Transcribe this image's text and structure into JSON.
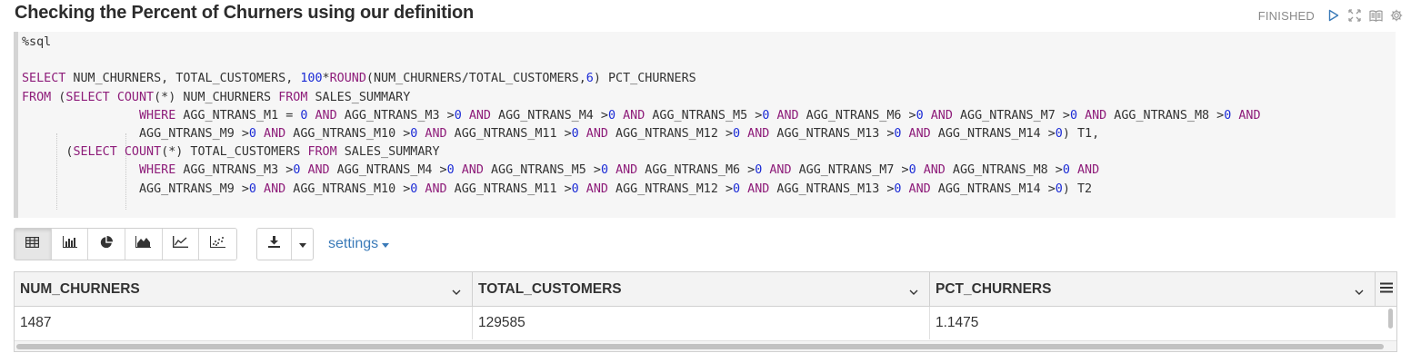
{
  "paragraph": {
    "title": "Checking the Percent of Churners using our definition",
    "status": "FINISHED",
    "controls": [
      "run-icon",
      "expand-icon",
      "book-icon",
      "gear-icon"
    ]
  },
  "editor": {
    "lines": [
      [
        {
          "t": "%sql",
          "c": ""
        }
      ],
      [
        {
          "t": "",
          "c": ""
        }
      ],
      [
        {
          "t": "SELECT",
          "c": "kw"
        },
        {
          "t": " NUM_CHURNERS, TOTAL_CUSTOMERS, ",
          "c": ""
        },
        {
          "t": "100",
          "c": "num"
        },
        {
          "t": "*",
          "c": ""
        },
        {
          "t": "ROUND",
          "c": "kw"
        },
        {
          "t": "(NUM_CHURNERS/TOTAL_CUSTOMERS,",
          "c": ""
        },
        {
          "t": "6",
          "c": "num"
        },
        {
          "t": ") PCT_CHURNERS",
          "c": ""
        }
      ],
      [
        {
          "t": "FROM",
          "c": "kw"
        },
        {
          "t": " (",
          "c": ""
        },
        {
          "t": "SELECT",
          "c": "kw"
        },
        {
          "t": " ",
          "c": ""
        },
        {
          "t": "COUNT",
          "c": "kw"
        },
        {
          "t": "(*) NUM_CHURNERS ",
          "c": ""
        },
        {
          "t": "FROM",
          "c": "kw"
        },
        {
          "t": " SALES_SUMMARY",
          "c": ""
        }
      ],
      [
        {
          "t": "                ",
          "c": ""
        },
        {
          "t": "WHERE",
          "c": "kw"
        },
        {
          "t": " AGG_NTRANS_M1 = ",
          "c": ""
        },
        {
          "t": "0",
          "c": "num"
        },
        {
          "t": " ",
          "c": ""
        },
        {
          "t": "AND",
          "c": "kw"
        },
        {
          "t": " AGG_NTRANS_M3 >",
          "c": ""
        },
        {
          "t": "0",
          "c": "num"
        },
        {
          "t": " ",
          "c": ""
        },
        {
          "t": "AND",
          "c": "kw"
        },
        {
          "t": " AGG_NTRANS_M4 >",
          "c": ""
        },
        {
          "t": "0",
          "c": "num"
        },
        {
          "t": " ",
          "c": ""
        },
        {
          "t": "AND",
          "c": "kw"
        },
        {
          "t": " AGG_NTRANS_M5 >",
          "c": ""
        },
        {
          "t": "0",
          "c": "num"
        },
        {
          "t": " ",
          "c": ""
        },
        {
          "t": "AND",
          "c": "kw"
        },
        {
          "t": " AGG_NTRANS_M6 >",
          "c": ""
        },
        {
          "t": "0",
          "c": "num"
        },
        {
          "t": " ",
          "c": ""
        },
        {
          "t": "AND",
          "c": "kw"
        },
        {
          "t": " AGG_NTRANS_M7 >",
          "c": ""
        },
        {
          "t": "0",
          "c": "num"
        },
        {
          "t": " ",
          "c": ""
        },
        {
          "t": "AND",
          "c": "kw"
        },
        {
          "t": " AGG_NTRANS_M8 >",
          "c": ""
        },
        {
          "t": "0",
          "c": "num"
        },
        {
          "t": " ",
          "c": ""
        },
        {
          "t": "AND",
          "c": "kw"
        }
      ],
      [
        {
          "t": "                AGG_NTRANS_M9 >",
          "c": ""
        },
        {
          "t": "0",
          "c": "num"
        },
        {
          "t": " ",
          "c": ""
        },
        {
          "t": "AND",
          "c": "kw"
        },
        {
          "t": " AGG_NTRANS_M10 >",
          "c": ""
        },
        {
          "t": "0",
          "c": "num"
        },
        {
          "t": " ",
          "c": ""
        },
        {
          "t": "AND",
          "c": "kw"
        },
        {
          "t": " AGG_NTRANS_M11 >",
          "c": ""
        },
        {
          "t": "0",
          "c": "num"
        },
        {
          "t": " ",
          "c": ""
        },
        {
          "t": "AND",
          "c": "kw"
        },
        {
          "t": " AGG_NTRANS_M12 >",
          "c": ""
        },
        {
          "t": "0",
          "c": "num"
        },
        {
          "t": " ",
          "c": ""
        },
        {
          "t": "AND",
          "c": "kw"
        },
        {
          "t": " AGG_NTRANS_M13 >",
          "c": ""
        },
        {
          "t": "0",
          "c": "num"
        },
        {
          "t": " ",
          "c": ""
        },
        {
          "t": "AND",
          "c": "kw"
        },
        {
          "t": " AGG_NTRANS_M14 >",
          "c": ""
        },
        {
          "t": "0",
          "c": "num"
        },
        {
          "t": ") T1,",
          "c": ""
        }
      ],
      [
        {
          "t": "      (",
          "c": ""
        },
        {
          "t": "SELECT",
          "c": "kw"
        },
        {
          "t": " ",
          "c": ""
        },
        {
          "t": "COUNT",
          "c": "kw"
        },
        {
          "t": "(*) TOTAL_CUSTOMERS ",
          "c": ""
        },
        {
          "t": "FROM",
          "c": "kw"
        },
        {
          "t": " SALES_SUMMARY",
          "c": ""
        }
      ],
      [
        {
          "t": "                ",
          "c": ""
        },
        {
          "t": "WHERE",
          "c": "kw"
        },
        {
          "t": " AGG_NTRANS_M3 >",
          "c": ""
        },
        {
          "t": "0",
          "c": "num"
        },
        {
          "t": " ",
          "c": ""
        },
        {
          "t": "AND",
          "c": "kw"
        },
        {
          "t": " AGG_NTRANS_M4 >",
          "c": ""
        },
        {
          "t": "0",
          "c": "num"
        },
        {
          "t": " ",
          "c": ""
        },
        {
          "t": "AND",
          "c": "kw"
        },
        {
          "t": " AGG_NTRANS_M5 >",
          "c": ""
        },
        {
          "t": "0",
          "c": "num"
        },
        {
          "t": " ",
          "c": ""
        },
        {
          "t": "AND",
          "c": "kw"
        },
        {
          "t": " AGG_NTRANS_M6 >",
          "c": ""
        },
        {
          "t": "0",
          "c": "num"
        },
        {
          "t": " ",
          "c": ""
        },
        {
          "t": "AND",
          "c": "kw"
        },
        {
          "t": " AGG_NTRANS_M7 >",
          "c": ""
        },
        {
          "t": "0",
          "c": "num"
        },
        {
          "t": " ",
          "c": ""
        },
        {
          "t": "AND",
          "c": "kw"
        },
        {
          "t": " AGG_NTRANS_M8 >",
          "c": ""
        },
        {
          "t": "0",
          "c": "num"
        },
        {
          "t": " ",
          "c": ""
        },
        {
          "t": "AND",
          "c": "kw"
        }
      ],
      [
        {
          "t": "                AGG_NTRANS_M9 >",
          "c": ""
        },
        {
          "t": "0",
          "c": "num"
        },
        {
          "t": " ",
          "c": ""
        },
        {
          "t": "AND",
          "c": "kw"
        },
        {
          "t": " AGG_NTRANS_M10 >",
          "c": ""
        },
        {
          "t": "0",
          "c": "num"
        },
        {
          "t": " ",
          "c": ""
        },
        {
          "t": "AND",
          "c": "kw"
        },
        {
          "t": " AGG_NTRANS_M11 >",
          "c": ""
        },
        {
          "t": "0",
          "c": "num"
        },
        {
          "t": " ",
          "c": ""
        },
        {
          "t": "AND",
          "c": "kw"
        },
        {
          "t": " AGG_NTRANS_M12 >",
          "c": ""
        },
        {
          "t": "0",
          "c": "num"
        },
        {
          "t": " ",
          "c": ""
        },
        {
          "t": "AND",
          "c": "kw"
        },
        {
          "t": " AGG_NTRANS_M13 >",
          "c": ""
        },
        {
          "t": "0",
          "c": "num"
        },
        {
          "t": " ",
          "c": ""
        },
        {
          "t": "AND",
          "c": "kw"
        },
        {
          "t": " AGG_NTRANS_M14 >",
          "c": ""
        },
        {
          "t": "0",
          "c": "num"
        },
        {
          "t": ") T2",
          "c": ""
        }
      ]
    ]
  },
  "toolbar": {
    "viz_buttons": [
      "table-icon",
      "bar-chart-icon",
      "pie-chart-icon",
      "area-chart-icon",
      "line-chart-icon",
      "scatter-chart-icon"
    ],
    "active_viz": "table-icon",
    "download_icon": "download-icon",
    "settings_label": "settings"
  },
  "result": {
    "columns": [
      "NUM_CHURNERS",
      "TOTAL_CUSTOMERS",
      "PCT_CHURNERS"
    ],
    "rows": [
      [
        "1487",
        "129585",
        "1.1475"
      ]
    ]
  },
  "colors": {
    "keyword": "#8e1d7a",
    "number": "#1b2bd6",
    "link": "#3a7ab8"
  }
}
